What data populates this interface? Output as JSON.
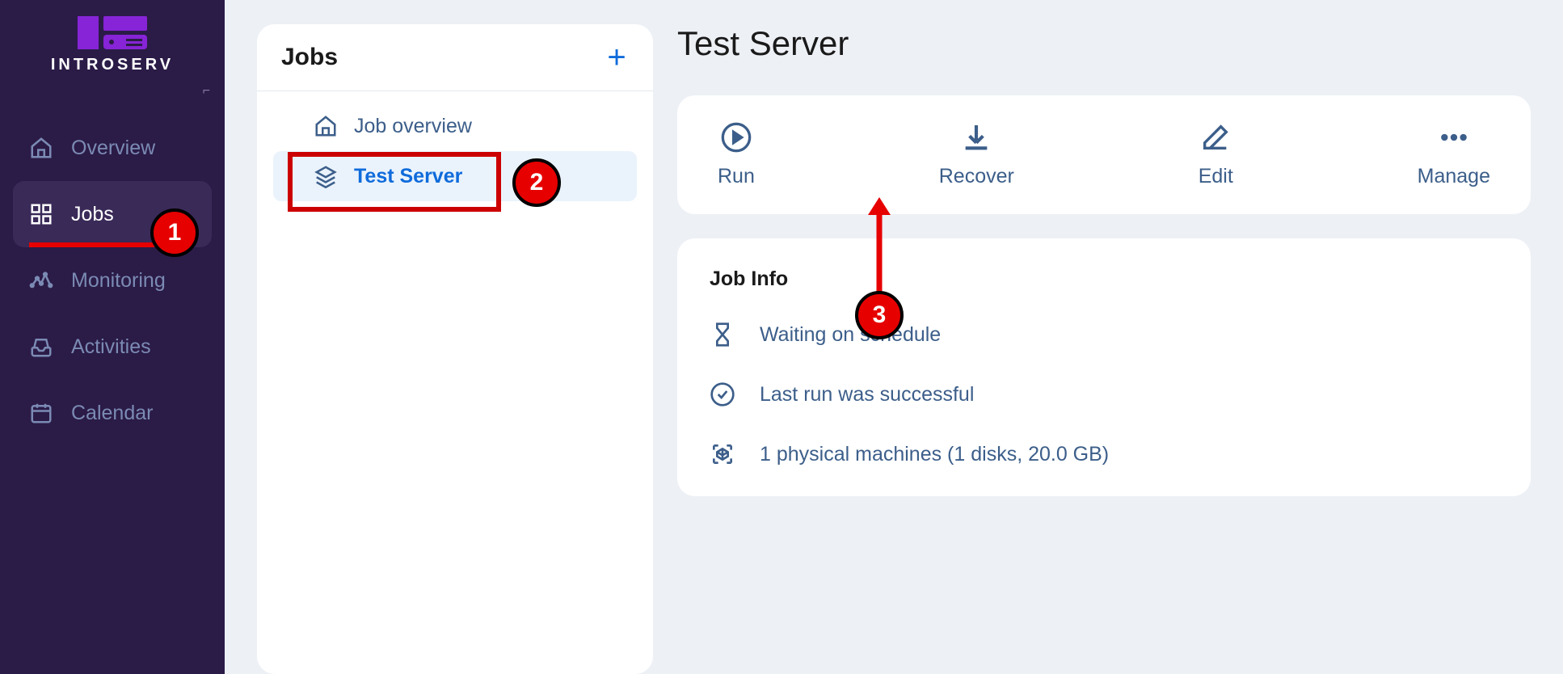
{
  "brand": "INTROSERV",
  "sidebar": {
    "items": [
      {
        "label": "Overview"
      },
      {
        "label": "Jobs"
      },
      {
        "label": "Monitoring"
      },
      {
        "label": "Activities"
      },
      {
        "label": "Calendar"
      }
    ]
  },
  "jobs_panel": {
    "title": "Jobs",
    "items": [
      {
        "label": "Job overview"
      },
      {
        "label": "Test Server"
      }
    ]
  },
  "main": {
    "title": "Test Server",
    "actions": [
      {
        "label": "Run"
      },
      {
        "label": "Recover"
      },
      {
        "label": "Edit"
      },
      {
        "label": "Manage"
      }
    ],
    "jobinfo": {
      "title": "Job Info",
      "rows": [
        {
          "text": "Waiting on schedule"
        },
        {
          "text": "Last run was successful"
        },
        {
          "text": "1 physical machines (1 disks, 20.0 GB)"
        }
      ]
    }
  },
  "callouts": {
    "one": "1",
    "two": "2",
    "three": "3"
  }
}
